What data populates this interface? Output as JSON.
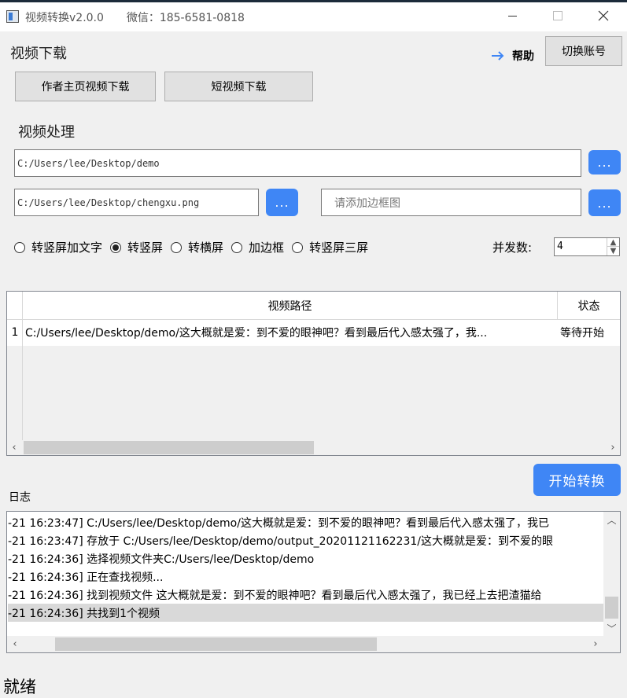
{
  "window": {
    "title": "视频转换v2.0.0",
    "wechat": "微信：185-6581-0818"
  },
  "download": {
    "section_title": "视频下载",
    "author_button": "作者主页视频下载",
    "short_button": "短视频下载"
  },
  "header_actions": {
    "help_label": "帮助",
    "switch_account": "切换账号"
  },
  "processing": {
    "section_title": "视频处理",
    "folder_path": "C:/Users/lee/Desktop/demo",
    "image_path": "C:/Users/lee/Desktop/chengxu.png",
    "frame_placeholder": "请添加边框图",
    "browse_label": "...",
    "modes": [
      {
        "label": "转竖屏加文字",
        "selected": false
      },
      {
        "label": "转竖屏",
        "selected": true
      },
      {
        "label": "转横屏",
        "selected": false
      },
      {
        "label": "加边框",
        "selected": false
      },
      {
        "label": "转竖屏三屏",
        "selected": false
      }
    ],
    "concurrency_label": "并发数:",
    "concurrency_value": "4"
  },
  "table": {
    "headers": [
      "视频路径",
      "状态"
    ],
    "rows": [
      {
        "index": "1",
        "path": "C:/Users/lee/Desktop/demo/这大概就是爱：到不爱的眼神吧？看到最后代入感太强了，我...",
        "status": "等待开始"
      }
    ]
  },
  "start_button": "开始转换",
  "log": {
    "label": "日志",
    "lines": [
      "-21 16:23:47] C:/Users/lee/Desktop/demo/这大概就是爱：到不爱的眼神吧？看到最后代入感太强了，我已",
      "-21 16:23:47] 存放于 C:/Users/lee/Desktop/demo/output_20201121162231/这大概就是爱：到不爱的眼",
      "-21 16:24:36] 选择视频文件夹C:/Users/lee/Desktop/demo",
      "-21 16:24:36] 正在查找视频...",
      "-21 16:24:36] 找到视频文件 这大概就是爱：到不爱的眼神吧？看到最后代入感太强了，我已经上去把渣猫给",
      "-21 16:24:36] 共找到1个视频"
    ]
  },
  "status_bar": "就绪",
  "colors": {
    "accent": "#3f86f5"
  }
}
